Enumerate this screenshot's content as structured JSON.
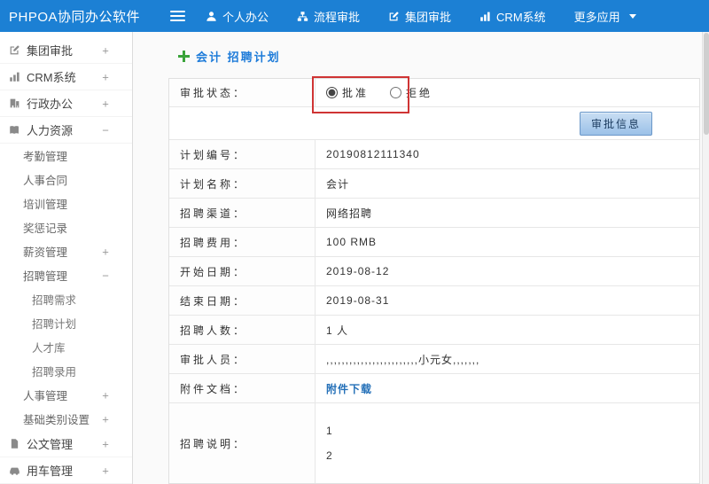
{
  "topbar": {
    "brand": "PHPOA协同办公软件",
    "menu": [
      {
        "label": "个人办公",
        "icon": "person-icon"
      },
      {
        "label": "流程审批",
        "icon": "flow-icon"
      },
      {
        "label": "集团审批",
        "icon": "edit-square-icon"
      },
      {
        "label": "CRM系统",
        "icon": "bar-chart-icon"
      },
      {
        "label": "更多应用",
        "icon": "chevron-down-icon"
      }
    ]
  },
  "sidebar": {
    "items": [
      {
        "label": "集团审批",
        "expander": "+",
        "icon": "edit-square-icon"
      },
      {
        "label": "CRM系统",
        "expander": "+",
        "icon": "bar-chart-icon"
      },
      {
        "label": "行政办公",
        "expander": "+",
        "icon": "building-icon"
      },
      {
        "label": "人力资源",
        "expander": "−",
        "icon": "book-icon"
      },
      {
        "label": "考勤管理"
      },
      {
        "label": "人事合同"
      },
      {
        "label": "培训管理"
      },
      {
        "label": "奖惩记录"
      },
      {
        "label": "薪资管理",
        "expander": "+"
      },
      {
        "label": "招聘管理",
        "expander": "−"
      },
      {
        "label": "招聘需求"
      },
      {
        "label": "招聘计划"
      },
      {
        "label": "人才库"
      },
      {
        "label": "招聘录用"
      },
      {
        "label": "人事管理",
        "expander": "+"
      },
      {
        "label": "基础类别设置",
        "expander": "+"
      },
      {
        "label": "公文管理",
        "expander": "+",
        "icon": "document-icon"
      },
      {
        "label": "用车管理",
        "expander": "+",
        "icon": "car-icon"
      }
    ]
  },
  "main": {
    "title": "会计 招聘计划",
    "approval_row": {
      "label": "审批状态：",
      "options": [
        {
          "label": "批准",
          "checked": true
        },
        {
          "label": "拒绝",
          "checked": false
        }
      ]
    },
    "approve_button": "审批信息",
    "fields": [
      {
        "label": "计划编号：",
        "value": "20190812111340"
      },
      {
        "label": "计划名称：",
        "value": "会计"
      },
      {
        "label": "招聘渠道：",
        "value": "网络招聘"
      },
      {
        "label": "招聘费用：",
        "value": "100 RMB"
      },
      {
        "label": "开始日期：",
        "value": "2019-08-12"
      },
      {
        "label": "结束日期：",
        "value": "2019-08-31"
      },
      {
        "label": "招聘人数：",
        "value": "1 人"
      },
      {
        "label": "审批人员：",
        "value": ",,,,,,,,,,,,,,,,,,,,,,,,小元女,,,,,,,"
      },
      {
        "label": "附件文档：",
        "value": "附件下载"
      }
    ],
    "description_row": {
      "label": "招聘说明：",
      "lines": [
        "1",
        "2"
      ]
    }
  },
  "colors": {
    "topbar_blue": "#1c80d4",
    "title_blue": "#1d7bd9",
    "plus_green": "#3aa33a",
    "annotation_red": "#cf3434",
    "link_blue": "#2470b8"
  }
}
